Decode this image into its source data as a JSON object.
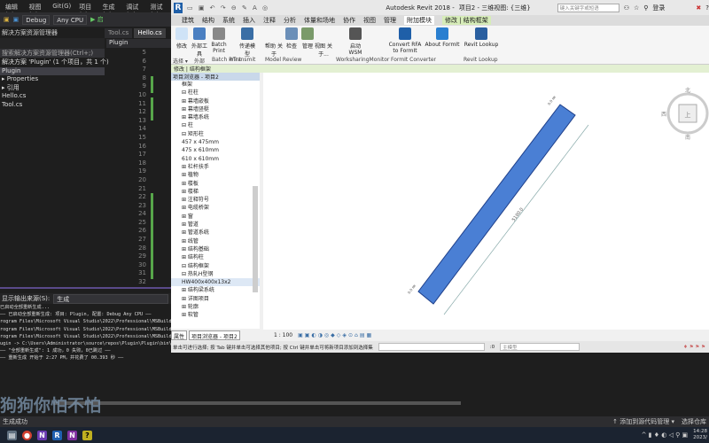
{
  "vs": {
    "menu": [
      "编辑(E)",
      "视图(V)",
      "Git(G)",
      "项目(P)",
      "生成(B)",
      "调试(D)",
      "测试(S)"
    ],
    "config": "Debug",
    "platform": "Any CPU",
    "start": "▶ 启",
    "solution_explorer": {
      "title": "解决方案资源管理器",
      "search": "搜索解决方案资源管理器(Ctrl+;)",
      "items": [
        {
          "label": "解决方案 'Plugin' (1 个项目，共 1 个)",
          "sel": false
        },
        {
          "label": "Plugin",
          "sel": true
        },
        {
          "label": "▸ Properties",
          "sel": false
        },
        {
          "label": "▸ 引用",
          "sel": false
        },
        {
          "label": "  Hello.cs",
          "sel": false
        },
        {
          "label": "  Tool.cs",
          "sel": false
        }
      ]
    },
    "editor_tabs": [
      {
        "label": "Tool.cs",
        "active": false
      },
      {
        "label": "Hello.cs",
        "active": true
      }
    ],
    "nav_project": "Plugin",
    "line_numbers": [
      "5",
      "6",
      "7",
      "8",
      "9",
      "10",
      "11",
      "12",
      "13",
      "14",
      "15",
      "16",
      "17",
      "18",
      "19",
      "20",
      "21",
      "22",
      "23",
      "24",
      "25",
      "26",
      "27",
      "28",
      "29",
      "30",
      "31",
      "32"
    ],
    "output": {
      "label": "显示输出来源(S):",
      "source": "生成",
      "lines": [
        "已启动全部重新生成...",
        "—— 已启动全部重新生成: 项目: Plugin, 配置: Debug Any CPU ——",
        "rogram Files\\Microsoft Visual Studio\\2022\\Professional\\MSBuild\\Current\\",
        "rogram Files\\Microsoft Visual Studio\\2022\\Professional\\MSBuild\\Current\\",
        "rogram Files\\Microsoft Visual Studio\\2022\\Professional\\MSBuild\\Current\\",
        "ugin -> C:\\Users\\Administrator\\source\\repos\\Plugin\\Plugin\\bin\\Debug\\Pl",
        "—— \"全部重新生成\": 1 成功，0 失败，0已跳过 ——",
        "—— 重新生成 开始于 2:27 PM，并花费了 00.393 秒 ——"
      ]
    },
    "watermark": "狗狗你怕不怕",
    "status": {
      "left": "生成成功",
      "source_control": "↑ 添加到源代码管理 ▾",
      "repo": "选择仓库"
    }
  },
  "revit": {
    "app_title": "Autodesk Revit 2018 -",
    "doc_title": "项目2 - 三维视图: {三维}",
    "search_placeholder": "键入关键字或短语",
    "login": "登录",
    "tabs": [
      {
        "label": "建筑"
      },
      {
        "label": "结构"
      },
      {
        "label": "系统"
      },
      {
        "label": "插入"
      },
      {
        "label": "注释"
      },
      {
        "label": "分析"
      },
      {
        "label": "体量和场地"
      },
      {
        "label": "协作"
      },
      {
        "label": "视图"
      },
      {
        "label": "管理"
      },
      {
        "label": "附加模块",
        "active": true
      },
      {
        "label": "修改 | 结构框架",
        "ctx": true
      }
    ],
    "ribbon": [
      {
        "label": "修改",
        "color": "#cfe3f7"
      },
      {
        "label": "外部工具",
        "color": "#4a7fc1"
      },
      {
        "label": "Batch Print",
        "color": "#888"
      },
      {
        "label": "传递模型",
        "color": "#3a6ea5"
      },
      {
        "label": "帮助 关于",
        "color": "#f5f5f5"
      },
      {
        "label": "检查",
        "color": "#6b8fb8"
      },
      {
        "label": "管理",
        "color": "#7a9a6a"
      },
      {
        "label": "视图 关于...",
        "color": "#f5f5f5"
      },
      {
        "label": "启动 WSM",
        "color": "#555"
      },
      {
        "label": "Convert RFA to FormIt",
        "color": "#1f5fa8"
      },
      {
        "label": "About FormIt",
        "color": "#2a7fd0"
      },
      {
        "label": "Revit Lookup",
        "color": "#2a5fa0"
      }
    ],
    "panels": [
      "选择 ▾",
      "外部",
      "Batch Print",
      "eTransmit",
      "Model Review",
      "WorksharingMonitor",
      "FormIt Converter",
      "Revit Lookup"
    ],
    "context_bar": "修改 | 结构框架",
    "browser": {
      "title": "项目浏览器 - 项目2",
      "items": [
        "        框架",
        "    ⊟ 柱柱",
        "⊞ 幕墙嵌板",
        "⊞ 幕墙竖梃",
        "⊞ 幕墙系统",
        "⊟ 柱",
        "    ⊟ 矩形柱",
        "         457 x 475mm",
        "         475 x 610mm",
        "         610 x 610mm",
        "⊞ 栏杆扶手",
        "⊞ 植物",
        "⊞ 楼板",
        "⊞ 楼梯",
        "⊞ 注释符号",
        "⊞ 电缆桥架",
        "⊞ 窗",
        "⊞ 管道",
        "⊞ 管道系统",
        "⊞ 线管",
        "⊞ 结构基础",
        "⊞ 结构柱",
        "⊟ 结构框架",
        "    ⊟ 热轧H型钢",
        "         HW400x400x13x2",
        "⊞ 结构梁系统",
        "⊞ 详图项目",
        "⊞ 轮廓",
        "⊞ 软管"
      ],
      "tabs": [
        "属性",
        "项目浏览器 - 项目2"
      ]
    },
    "viewcube": {
      "north": "北",
      "west": "西",
      "south": "南",
      "face": "上"
    },
    "dimension": "5100.0",
    "offset_label": "0.0 ㎜",
    "scale": "1 : 100",
    "status_hint": "单击可进行选择; 按 Tab 键并单击可选择其他项目; 按 Ctrl 键并单击可将新项目添加到选择集",
    "status_value": ":0",
    "model_combo": "主模型"
  },
  "taskbar": {
    "time": "14:28",
    "date": "2023/"
  }
}
